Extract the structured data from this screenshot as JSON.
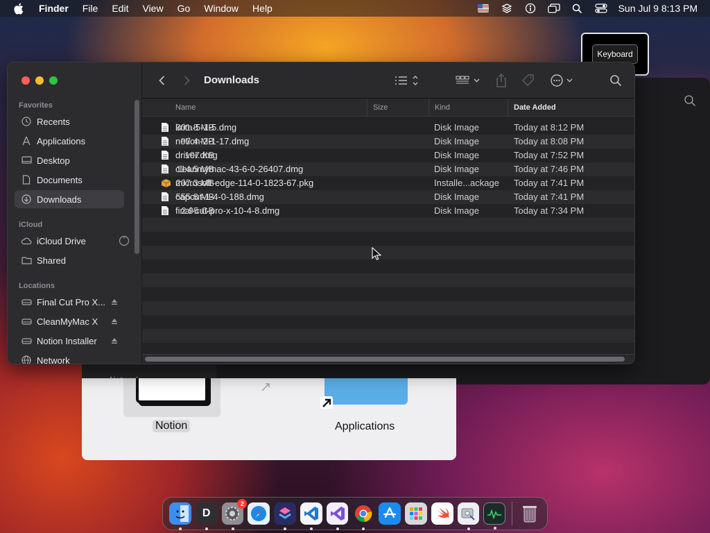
{
  "menubar": {
    "app_name": "Finder",
    "menus": [
      "File",
      "Edit",
      "View",
      "Go",
      "Window",
      "Help"
    ],
    "status_icons": [
      "keyboard-flag-icon",
      "layers-icon",
      "accessibility-icon",
      "screen-mirroring-icon",
      "spotlight-search-icon",
      "control-center-icon"
    ],
    "clock": "Sun Jul 9  8:13 PM"
  },
  "keyboard_popup": {
    "label": "Keyboard"
  },
  "finder": {
    "title": "Downloads",
    "sidebar": {
      "sections": [
        {
          "label": "Favorites",
          "items": [
            {
              "label": "Recents",
              "icon": "clock-icon"
            },
            {
              "label": "Applications",
              "icon": "applications-icon"
            },
            {
              "label": "Desktop",
              "icon": "desktop-icon"
            },
            {
              "label": "Documents",
              "icon": "document-icon"
            },
            {
              "label": "Downloads",
              "icon": "download-icon",
              "selected": true
            }
          ]
        },
        {
          "label": "iCloud",
          "items": [
            {
              "label": "iCloud Drive",
              "icon": "cloud-icon"
            },
            {
              "label": "Shared",
              "icon": "shared-folder-icon"
            }
          ]
        },
        {
          "label": "Locations",
          "items": [
            {
              "label": "Final Cut Pro X...",
              "icon": "drive-icon"
            },
            {
              "label": "CleanMyMac X",
              "icon": "drive-icon"
            },
            {
              "label": "Notion Installer",
              "icon": "drive-icon"
            },
            {
              "label": "Network",
              "icon": "network-icon"
            }
          ]
        }
      ]
    },
    "columns": {
      "name": "Name",
      "size": "Size",
      "kind": "Kind",
      "date_added": "Date Added"
    },
    "files": [
      {
        "name": "krita-5-1-5.dmg",
        "size": "301.8 MB",
        "kind": "Disk Image",
        "date_added": "Today at 8:12 PM",
        "type": "dmg"
      },
      {
        "name": "notion-2-1-17.dmg",
        "size": "97.4 MB",
        "kind": "Disk Image",
        "date_added": "Today at 8:08 PM",
        "type": "dmg"
      },
      {
        "name": "driver.dmg",
        "size": "107 KB",
        "kind": "Disk Image",
        "date_added": "Today at 7:52 PM",
        "type": "dmg"
      },
      {
        "name": "cleanmymac-43-6-0-26407.dmg",
        "size": "114.5 MB",
        "kind": "Disk Image",
        "date_added": "Today at 7:46 PM",
        "type": "dmg"
      },
      {
        "name": "microsoft-edge-114-0-1823-67.pkg",
        "size": "207.3 MB",
        "kind": "Installe...ackage",
        "date_added": "Today at 7:41 PM",
        "type": "pkg"
      },
      {
        "name": "capcut-1-4-0-188.dmg",
        "size": "555.8 MB",
        "kind": "Disk Image",
        "date_added": "Today at 7:41 PM",
        "type": "dmg"
      },
      {
        "name": "final-cut-pro-x-10-4-8.dmg",
        "size": "2.95 GB",
        "kind": "Disk Image",
        "date_added": "Today at 7:34 PM",
        "type": "dmg"
      }
    ]
  },
  "background_window": {
    "network_label": "Network",
    "installer": {
      "app_label": "Notion",
      "target_label": "Applications"
    }
  },
  "dock": {
    "apps": [
      {
        "name": "finder",
        "glyph": "",
        "color": "#3d8ef0",
        "running": true
      },
      {
        "name": "d-app",
        "glyph": "D",
        "color": "#2f2f33",
        "running": true
      },
      {
        "name": "system-settings",
        "glyph": "⚙",
        "color": "#8e8e93",
        "running": true,
        "badge": "2"
      },
      {
        "name": "safari",
        "glyph": "✦",
        "color": "#1e88e5",
        "running": false
      },
      {
        "name": "shortcuts",
        "glyph": "◆",
        "color": "#6d44d6",
        "running": true
      },
      {
        "name": "vscode",
        "glyph": "⟩",
        "color": "#1e7ad1",
        "running": true
      },
      {
        "name": "visual-studio",
        "glyph": "∞",
        "color": "#7b4fd6",
        "running": true
      },
      {
        "name": "chrome",
        "glyph": "●",
        "color": "#e9e9ea",
        "running": true
      },
      {
        "name": "app-store",
        "glyph": "A",
        "color": "#1a8cf0",
        "running": false
      },
      {
        "name": "launchpad",
        "glyph": "▦",
        "color": "#c7c7cc",
        "running": false
      },
      {
        "name": "swift",
        "glyph": "➶",
        "color": "#f05138",
        "running": false
      },
      {
        "name": "disk-utility",
        "glyph": "▣",
        "color": "#bfc4cc",
        "running": true
      },
      {
        "name": "activity-monitor",
        "glyph": "∿",
        "color": "#1d2a2a",
        "running": true
      }
    ],
    "trash": {
      "name": "trash",
      "glyph": "🗑",
      "color": "#8a8a8f"
    }
  }
}
